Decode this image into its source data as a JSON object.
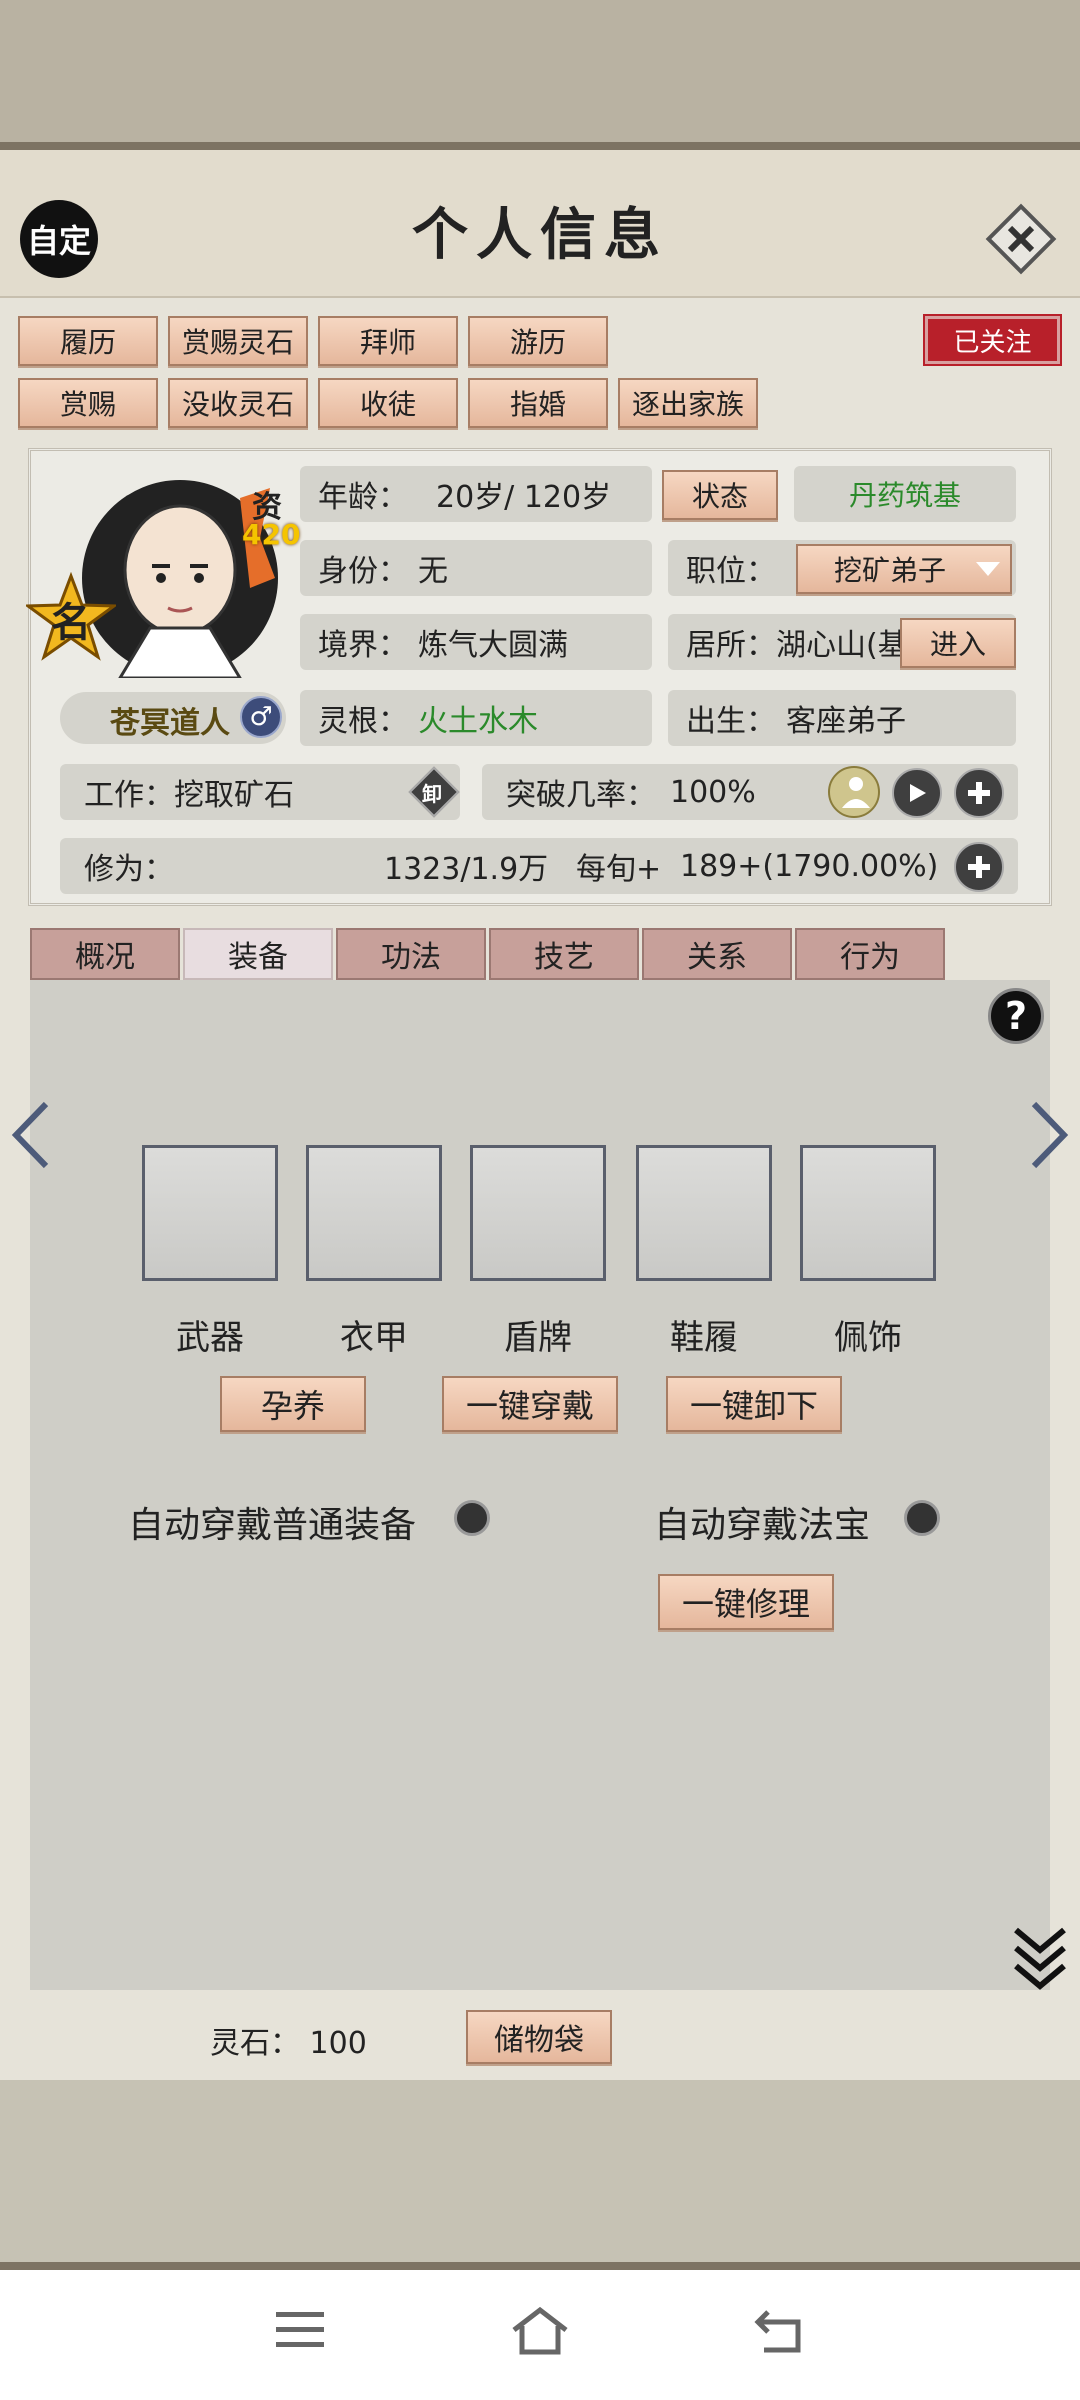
{
  "header": {
    "title": "个人信息",
    "auto_label": "自定",
    "follow_label": "已关注"
  },
  "actions": {
    "row1": [
      "履历",
      "赏赐灵石",
      "拜师",
      "游历"
    ],
    "row2": [
      "赏赐",
      "没收灵石",
      "收徒",
      "指婚",
      "逐出家族"
    ]
  },
  "profile": {
    "zi_label": "资",
    "zi_value": "420",
    "name_badge": "名",
    "character_name": "苍冥道人",
    "gender_icon": "male-icon",
    "age_label": "年龄：",
    "age_value": "20岁/ 120岁",
    "status_button": "状态",
    "status_value": "丹药筑基",
    "identity_label": "身份：",
    "identity_value": "无",
    "position_label": "职位：",
    "position_value": "挖矿弟子",
    "realm_label": "境界：",
    "realm_value": "炼气大圆满",
    "residence_label": "居所：",
    "residence_value": "湖心山(基",
    "enter_button": "进入",
    "root_label": "灵根：",
    "root_value": "火土水木",
    "birth_label": "出生：",
    "birth_value": "客座弟子",
    "work_label": "工作：",
    "work_value": "挖取矿石",
    "unload_icon": "卸",
    "breakthrough_label": "突破几率：",
    "breakthrough_value": "100%",
    "cultivation_label": "修为：",
    "cultivation_value": "1323/1.9万",
    "per_tick_label": "每旬+",
    "per_tick_value": "189+(1790.00%)"
  },
  "tabs": [
    "概况",
    "装备",
    "功法",
    "技艺",
    "关系",
    "行为"
  ],
  "active_tab": "装备",
  "equipment": {
    "slots": [
      "武器",
      "衣甲",
      "盾牌",
      "鞋履",
      "佩饰"
    ],
    "nurture_button": "孕养",
    "equip_all_button": "一键穿戴",
    "unequip_all_button": "一键卸下",
    "auto_equip_normal": "自动穿戴普通装备",
    "auto_equip_treasure": "自动穿戴法宝",
    "repair_all_button": "一键修理"
  },
  "footer": {
    "spirit_stone_label": "灵石：",
    "spirit_stone_value": "100",
    "bag_button": "储物袋"
  },
  "colors": {
    "accent_red": "#b8202a",
    "root_green": "#2b8a2b",
    "button_peach": "#e5b79c"
  }
}
